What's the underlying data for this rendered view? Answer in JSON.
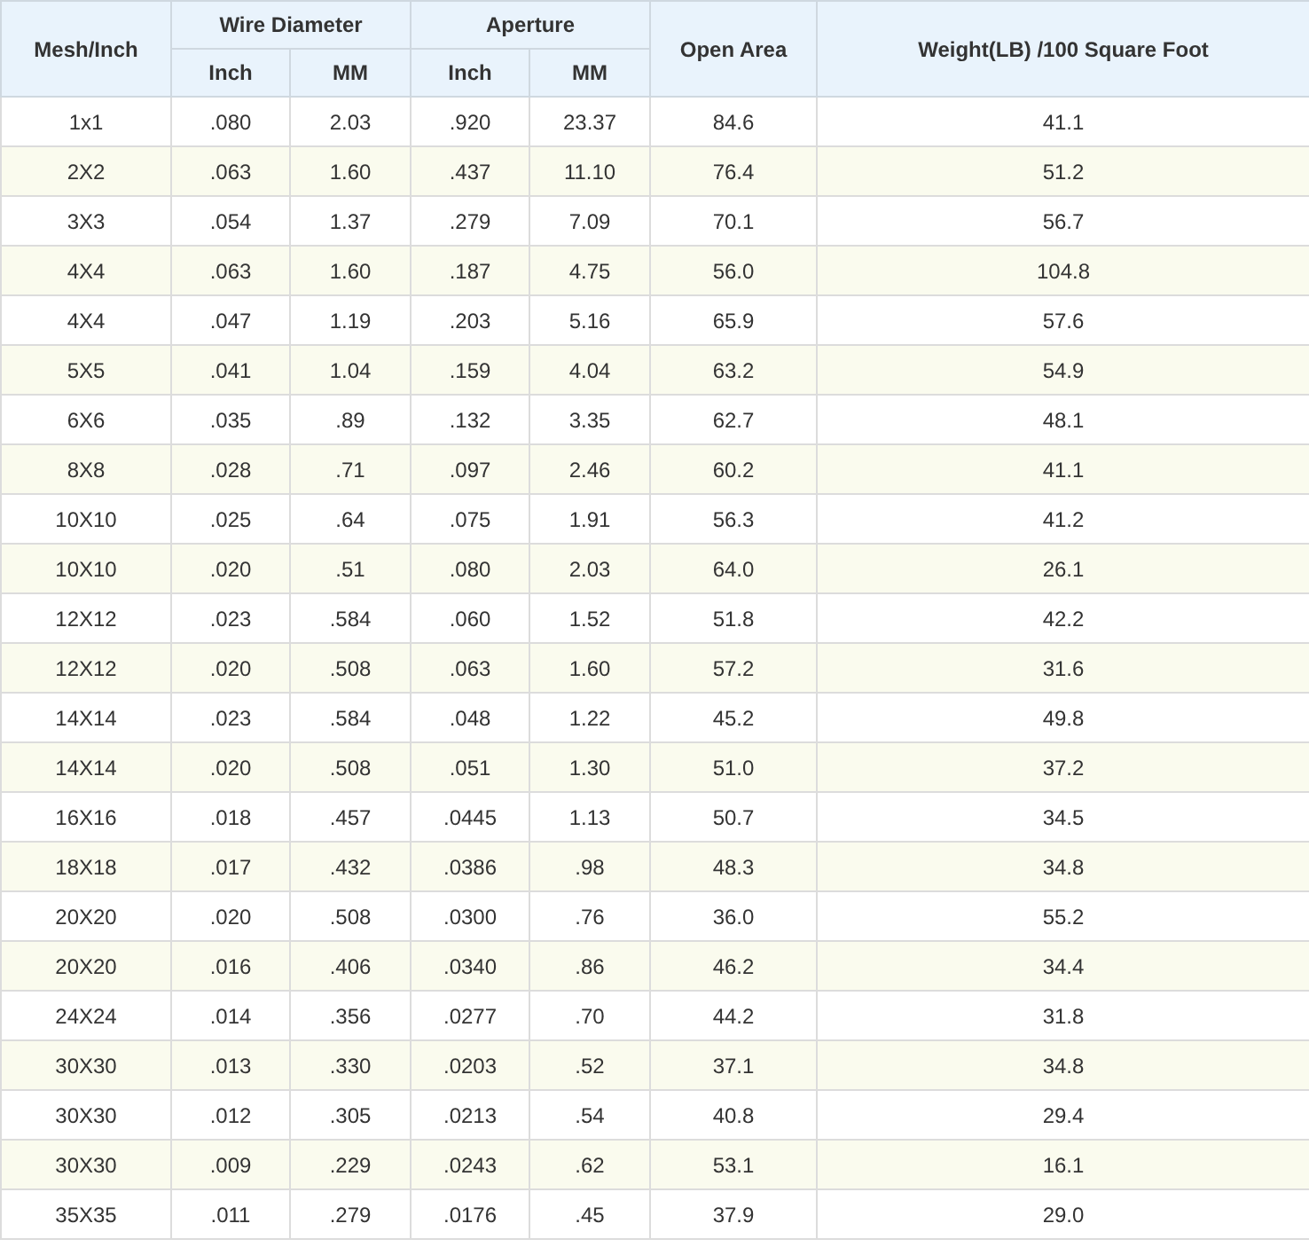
{
  "table": {
    "header_rows": [
      [
        {
          "label": "Mesh/Inch",
          "rowspan": 2
        },
        {
          "label": "Wire Diameter",
          "colspan": 2
        },
        {
          "label": "Aperture",
          "colspan": 2
        },
        {
          "label": "Open Area",
          "rowspan": 2
        },
        {
          "label": "Weight(LB) /100 Square Foot",
          "rowspan": 2
        }
      ],
      [
        {
          "label": "Inch"
        },
        {
          "label": "MM"
        },
        {
          "label": "Inch"
        },
        {
          "label": "MM"
        }
      ]
    ],
    "rows": [
      [
        "1x1",
        ".080",
        "2.03",
        ".920",
        "23.37",
        "84.6",
        "41.1"
      ],
      [
        "2X2",
        ".063",
        "1.60",
        ".437",
        "11.10",
        "76.4",
        "51.2"
      ],
      [
        "3X3",
        ".054",
        "1.37",
        ".279",
        "7.09",
        "70.1",
        "56.7"
      ],
      [
        "4X4",
        ".063",
        "1.60",
        ".187",
        "4.75",
        "56.0",
        "104.8"
      ],
      [
        "4X4",
        ".047",
        "1.19",
        ".203",
        "5.16",
        "65.9",
        "57.6"
      ],
      [
        "5X5",
        ".041",
        "1.04",
        ".159",
        "4.04",
        "63.2",
        "54.9"
      ],
      [
        "6X6",
        ".035",
        ".89",
        ".132",
        "3.35",
        "62.7",
        "48.1"
      ],
      [
        "8X8",
        ".028",
        ".71",
        ".097",
        "2.46",
        "60.2",
        "41.1"
      ],
      [
        "10X10",
        ".025",
        ".64",
        ".075",
        "1.91",
        "56.3",
        "41.2"
      ],
      [
        "10X10",
        ".020",
        ".51",
        ".080",
        "2.03",
        "64.0",
        "26.1"
      ],
      [
        "12X12",
        ".023",
        ".584",
        ".060",
        "1.52",
        "51.8",
        "42.2"
      ],
      [
        "12X12",
        ".020",
        ".508",
        ".063",
        "1.60",
        "57.2",
        "31.6"
      ],
      [
        "14X14",
        ".023",
        ".584",
        ".048",
        "1.22",
        "45.2",
        "49.8"
      ],
      [
        "14X14",
        ".020",
        ".508",
        ".051",
        "1.30",
        "51.0",
        "37.2"
      ],
      [
        "16X16",
        ".018",
        ".457",
        ".0445",
        "1.13",
        "50.7",
        "34.5"
      ],
      [
        "18X18",
        ".017",
        ".432",
        ".0386",
        ".98",
        "48.3",
        "34.8"
      ],
      [
        "20X20",
        ".020",
        ".508",
        ".0300",
        ".76",
        "36.0",
        "55.2"
      ],
      [
        "20X20",
        ".016",
        ".406",
        ".0340",
        ".86",
        "46.2",
        "34.4"
      ],
      [
        "24X24",
        ".014",
        ".356",
        ".0277",
        ".70",
        "44.2",
        "31.8"
      ],
      [
        "30X30",
        ".013",
        ".330",
        ".0203",
        ".52",
        "37.1",
        "34.8"
      ],
      [
        "30X30",
        ".012",
        ".305",
        ".0213",
        ".54",
        "40.8",
        "29.4"
      ],
      [
        "30X30",
        ".009",
        ".229",
        ".0243",
        ".62",
        "53.1",
        "16.1"
      ],
      [
        "35X35",
        ".011",
        ".279",
        ".0176",
        ".45",
        "37.9",
        "29.0"
      ]
    ]
  }
}
